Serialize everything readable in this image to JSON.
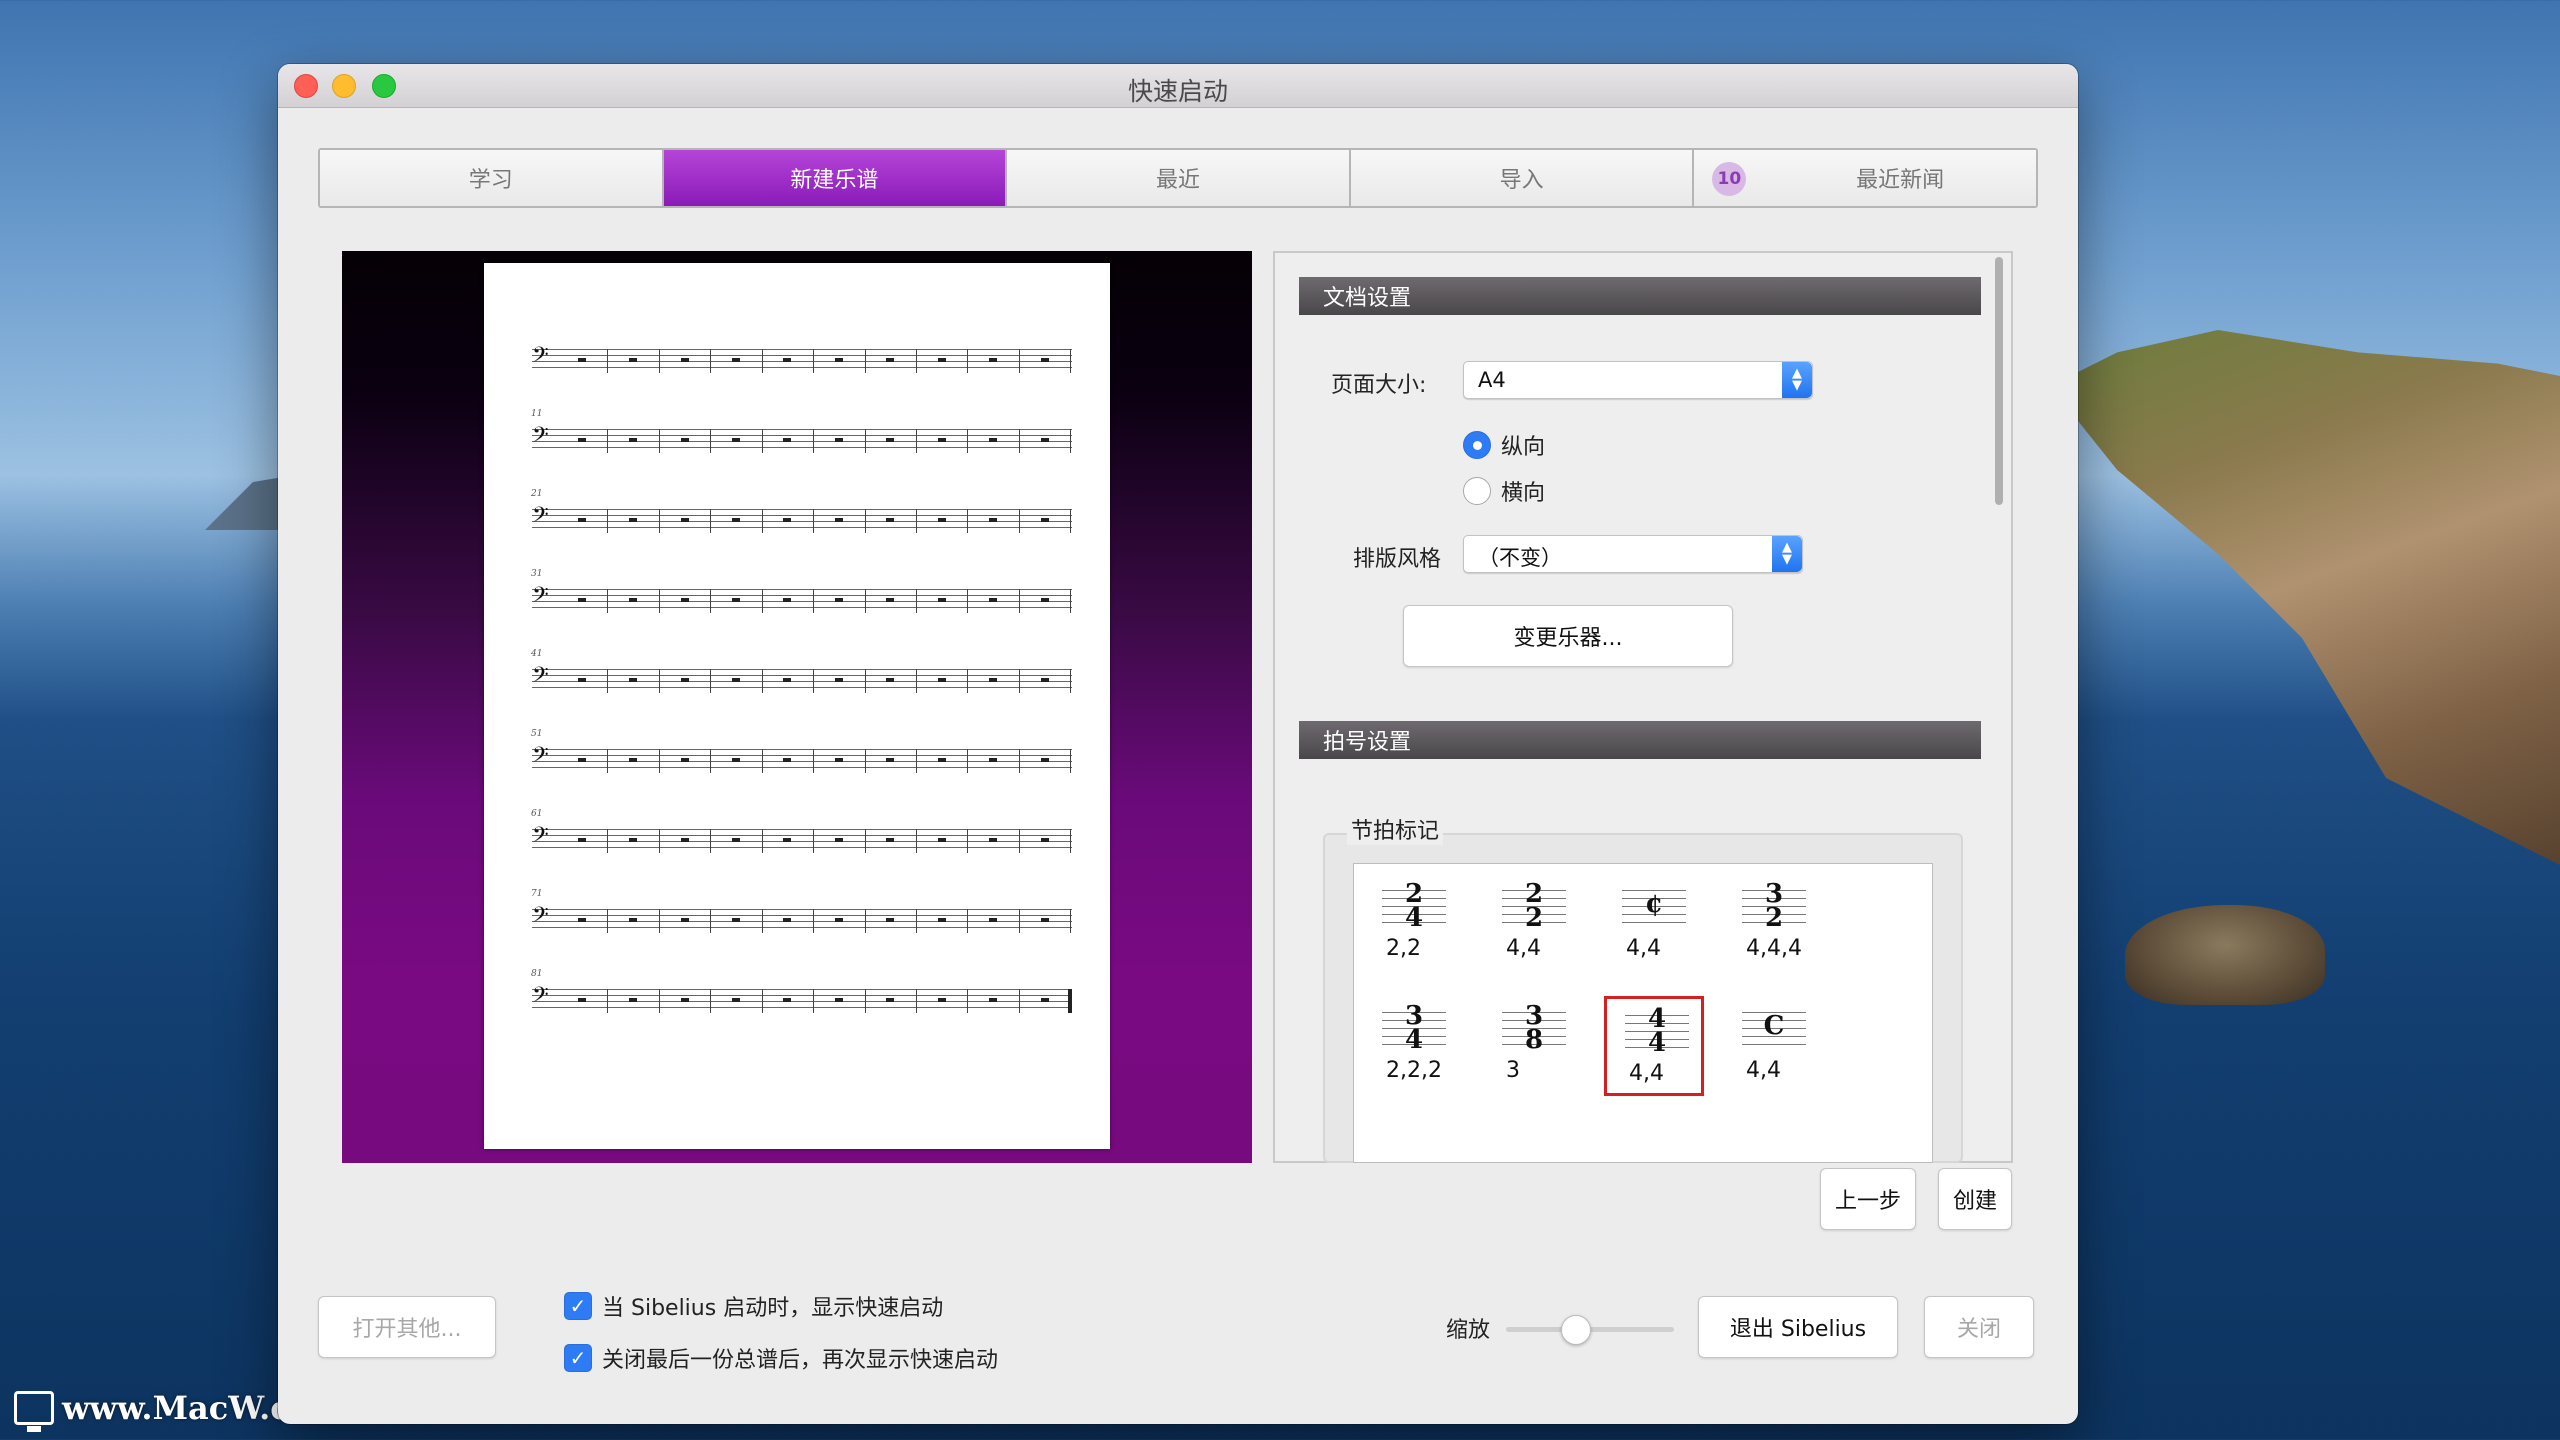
{
  "window": {
    "title": "快速启动"
  },
  "tabs": [
    {
      "label": "学习",
      "active": false
    },
    {
      "label": "新建乐谱",
      "active": true
    },
    {
      "label": "最近",
      "active": false
    },
    {
      "label": "导入",
      "active": false
    },
    {
      "label": "最近新闻",
      "active": false,
      "badge": "10"
    }
  ],
  "preview": {
    "measure_numbers": [
      "",
      "11",
      "21",
      "31",
      "41",
      "51",
      "61",
      "71",
      "81"
    ],
    "clef": "𝄢"
  },
  "document_settings": {
    "header": "文档设置",
    "page_size_label": "页面大小:",
    "page_size_value": "A4",
    "orientation": {
      "portrait_label": "纵向",
      "landscape_label": "横向",
      "selected": "portrait"
    },
    "house_style_label": "排版风格",
    "house_style_value": "（不变）",
    "change_instruments_button": "变更乐器..."
  },
  "time_signature_settings": {
    "header": "拍号设置",
    "group_label": "节拍标记",
    "items": [
      {
        "symbol": "2/4",
        "beams": "2,2",
        "selected": false
      },
      {
        "symbol": "2/2",
        "beams": "4,4",
        "selected": false
      },
      {
        "symbol": "¢",
        "beams": "4,4",
        "selected": false
      },
      {
        "symbol": "3/2",
        "beams": "4,4,4",
        "selected": false
      },
      {
        "symbol": "3/4",
        "beams": "2,2,2",
        "selected": false
      },
      {
        "symbol": "3/8",
        "beams": "3",
        "selected": false
      },
      {
        "symbol": "4/4",
        "beams": "4,4",
        "selected": true
      },
      {
        "symbol": "C",
        "beams": "4,4",
        "selected": false
      }
    ]
  },
  "nav_buttons": {
    "back": "上一步",
    "create": "创建"
  },
  "footer": {
    "open_other": "打开其他...",
    "check_show_on_start": {
      "label": "当 Sibelius 启动时，显示快速启动",
      "checked": true
    },
    "check_show_after_close": {
      "label": "关闭最后一份总谱后，再次显示快速启动",
      "checked": true
    },
    "zoom_label": "缩放",
    "zoom_level": 0.4,
    "quit": "退出 Sibelius",
    "close": "关闭"
  },
  "desktop": {
    "watermark": "www.MacW.com"
  },
  "colors": {
    "accent_purple": "#9b2fc9",
    "selection_red": "#d42020",
    "control_blue": "#2d7cf6"
  }
}
